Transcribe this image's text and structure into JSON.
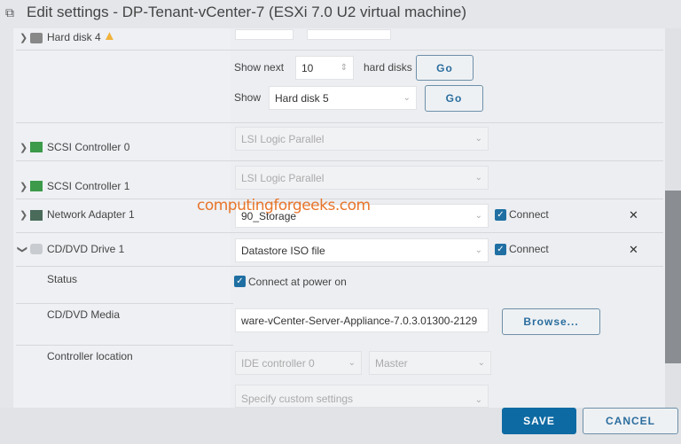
{
  "window": {
    "title": "Edit settings - DP-Tenant-vCenter-7 (ESXi 7.0 U2 virtual machine)"
  },
  "devices": {
    "hard_disk_4": {
      "label": "Hard disk 4"
    },
    "pagination": {
      "show_next_label": "Show next",
      "show_next_value": "10",
      "hard_disks_label": "hard disks",
      "go1": "Go",
      "show_label": "Show",
      "show_value": "Hard disk 5",
      "go2": "Go"
    },
    "scsi0": {
      "label": "SCSI Controller 0",
      "type": "LSI Logic Parallel"
    },
    "scsi1": {
      "label": "SCSI Controller 1",
      "type": "LSI Logic Parallel"
    },
    "network": {
      "label": "Network Adapter 1",
      "network": "90_Storage",
      "connect": "Connect",
      "connected": true
    },
    "cddvd": {
      "label": "CD/DVD Drive 1",
      "source": "Datastore ISO file",
      "connect": "Connect",
      "connected": true,
      "status_label": "Status",
      "connect_power_on": "Connect at power on",
      "media_label": "CD/DVD Media",
      "media_value": "ware-vCenter-Server-Appliance-7.0.3.01300-2129",
      "browse": "Browse...",
      "controller_label": "Controller location",
      "controller": "IDE controller 0",
      "position": "Master"
    },
    "next_select": "Specify custom settings"
  },
  "footer": {
    "save": "SAVE",
    "cancel": "CANCEL"
  },
  "watermark": "computingforgeeks.com"
}
